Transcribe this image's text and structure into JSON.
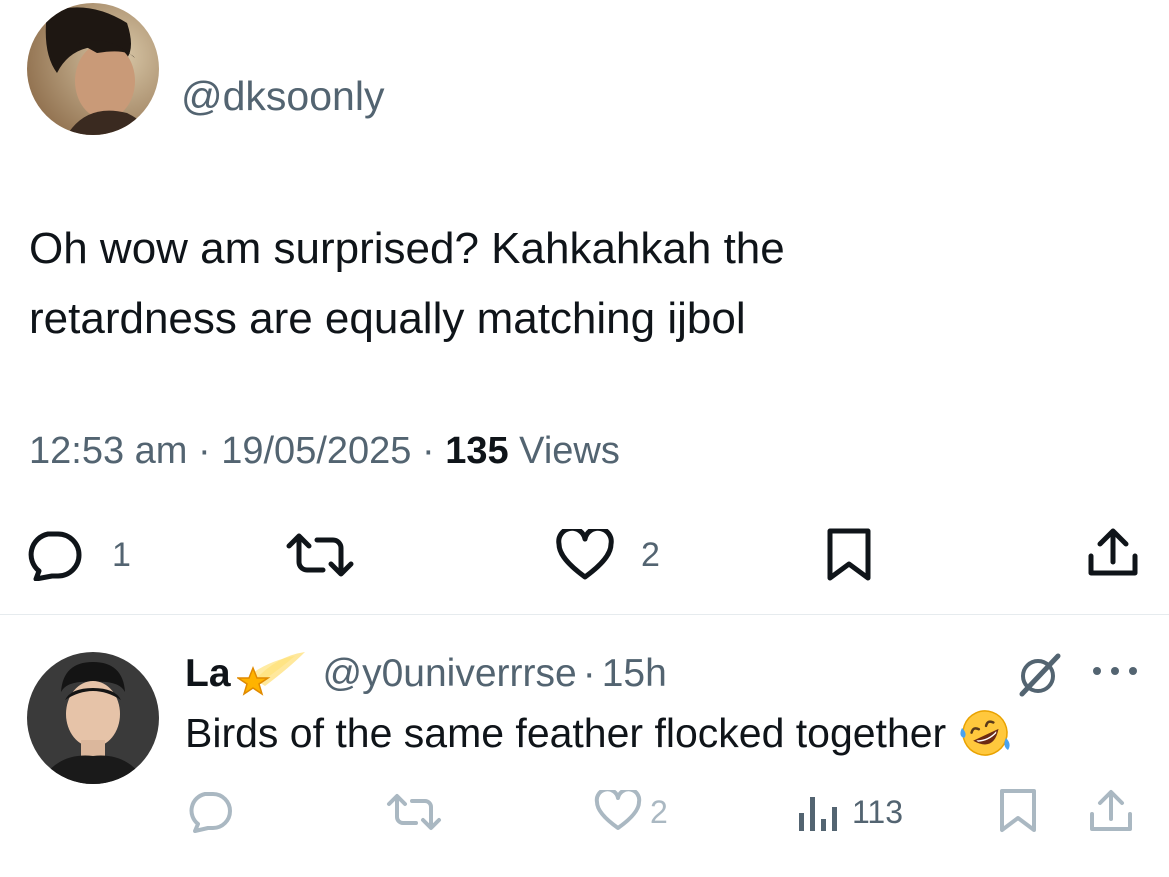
{
  "tweet": {
    "handle": "@dksoonly",
    "text_lines": [
      "Oh wow am surprised? Kahkahkah the",
      "retardness are equally matching ijbol"
    ],
    "time": "12:53 am",
    "separator": "·",
    "date": "19/05/2025",
    "views_count": "135",
    "views_label": "Views",
    "actions": {
      "reply_count": "1",
      "like_count": "2"
    }
  },
  "reply": {
    "display_name": "La",
    "handle": "@y0univerrrse",
    "separator": "·",
    "time": "15h",
    "text": "Birds of the same feather flocked together",
    "actions": {
      "like_count": "2",
      "views_count": "113"
    }
  },
  "colors": {
    "text_primary": "#0f1419",
    "text_secondary": "#536471",
    "icon_muted": "#aab8c2",
    "divider": "#e6ebee"
  },
  "icons": {
    "reply": "speech-bubble-icon",
    "repost": "repost-arrows-icon",
    "like": "heart-icon",
    "bookmark": "bookmark-icon",
    "share": "share-upload-icon",
    "views": "bar-chart-icon",
    "grok": "grok-slash-icon",
    "more": "more-dots-icon",
    "name_emoji": "shooting-star-emoji",
    "text_emoji": "rofl-emoji"
  }
}
